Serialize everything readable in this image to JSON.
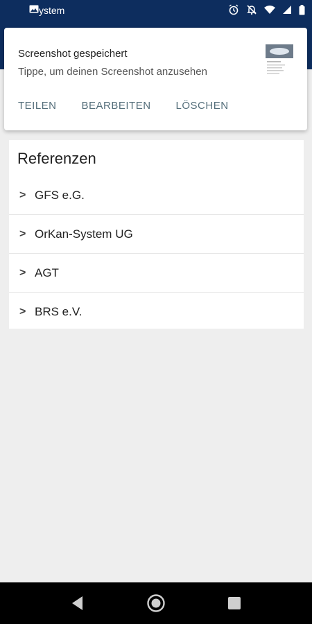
{
  "status": {
    "app_name": "ystem",
    "icons": [
      "image-icon",
      "alarm-icon",
      "notifications-off-icon",
      "wifi-icon",
      "signal-icon",
      "battery-icon"
    ]
  },
  "notification": {
    "title": "Screenshot gespeichert",
    "text": "Tippe, um deinen Screenshot anzusehen",
    "actions": [
      "TEILEN",
      "BEARBEITEN",
      "LÖSCHEN"
    ]
  },
  "card": {
    "title": "Referenzen",
    "items": [
      {
        "label": "GFS e.G."
      },
      {
        "label": "OrKan-System UG"
      },
      {
        "label": "AGT"
      },
      {
        "label": "BRS e.V."
      }
    ]
  },
  "colors": {
    "appbar": "#0d2d5e",
    "background": "#eeeeee",
    "action_text": "#546e7a"
  }
}
